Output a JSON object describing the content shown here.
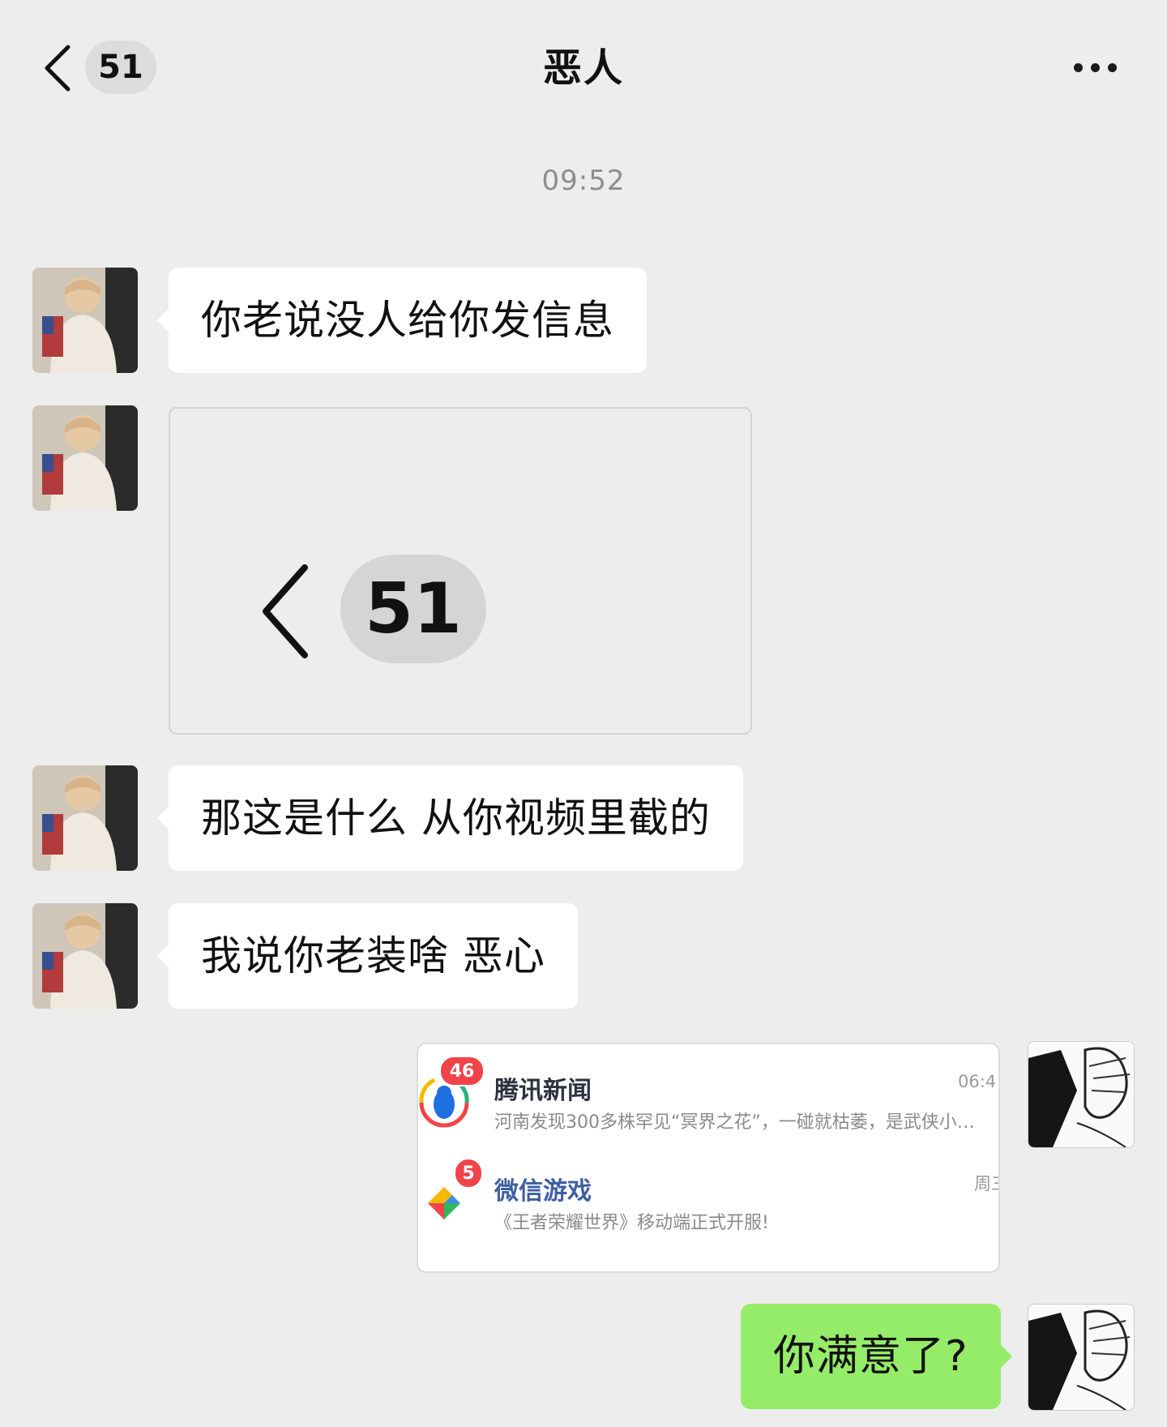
{
  "header": {
    "back_count": "51",
    "title": "恶人"
  },
  "timestamp": "09:52",
  "messages": {
    "m1": "你老说没人给你发信息",
    "m2_image": {
      "count": "51"
    },
    "m3": "那这是什么 从你视频里截的",
    "m4": "我说你老装啥 恶心",
    "m5_notifications": [
      {
        "badge": "46",
        "title": "腾讯新闻",
        "subtitle": "河南发现300多株罕见“冥界之花”，一碰就枯萎，是武侠小…",
        "time": "06:4"
      },
      {
        "badge": "5",
        "title": "微信游戏",
        "subtitle": "《王者荣耀世界》移动端正式开服!",
        "time": "周三"
      }
    ],
    "m6": "你满意了?"
  },
  "colors": {
    "background": "#ededed",
    "bubble_received": "#ffffff",
    "bubble_sent": "#95ec69",
    "badge_red": "#f0444a"
  }
}
